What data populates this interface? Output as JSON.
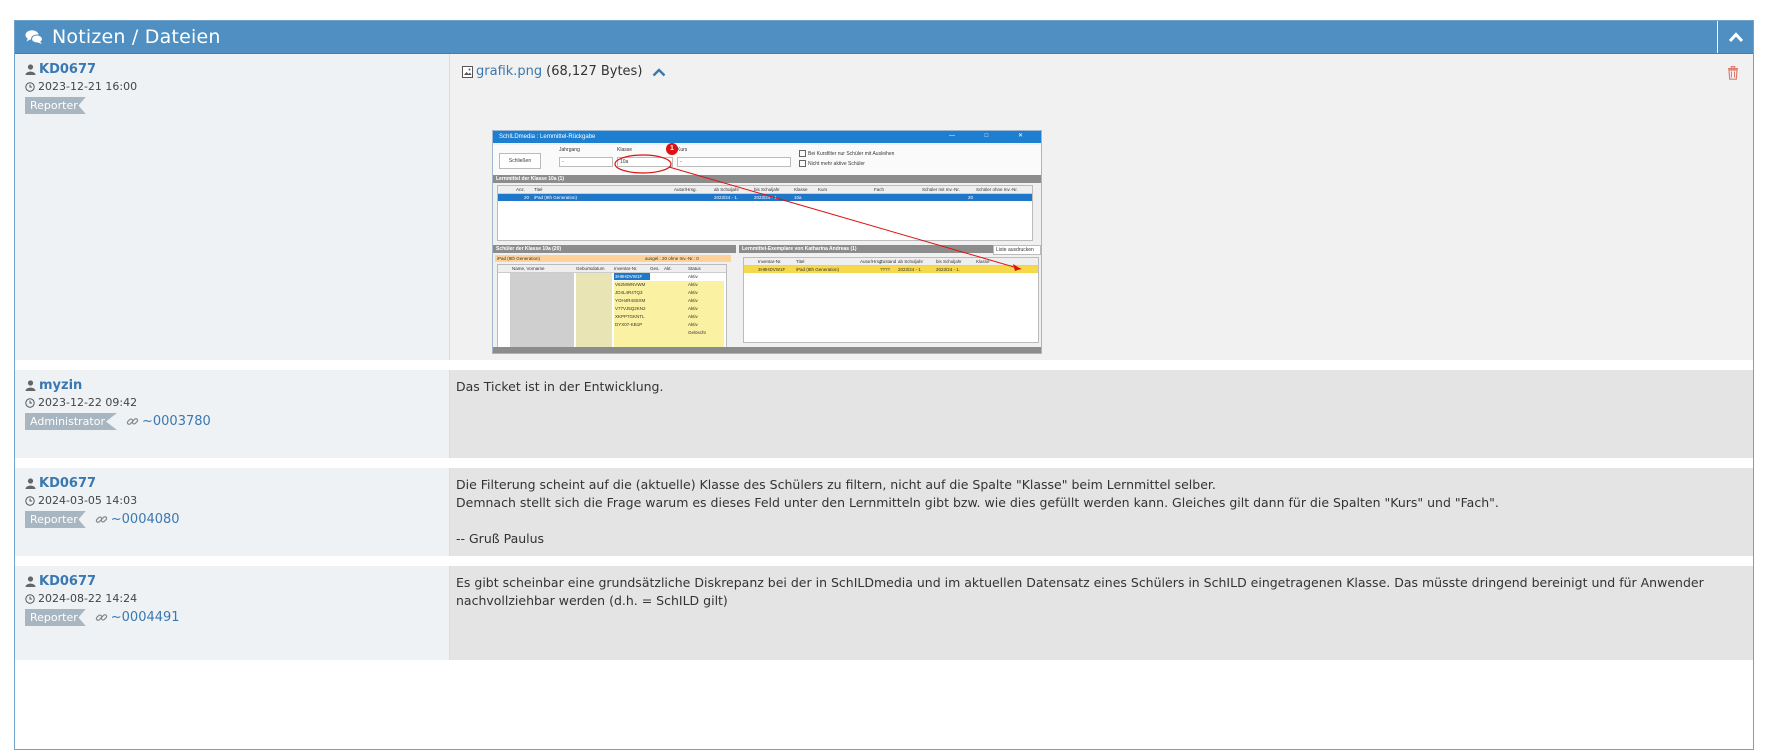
{
  "panel": {
    "title": "Notizen / Dateien",
    "header_color": "#4f8fc1"
  },
  "notes": [
    {
      "user": "KD0677",
      "date": "2023-12-21 16:00",
      "role": "Reporter",
      "link": "",
      "attachment": {
        "file_name": "grafik.png",
        "file_size": "(68,127 Bytes)",
        "preview": {
          "window_title": "SchILDmedia : Lernmittel-Rückgabe",
          "close_button": "Schließen",
          "filter_labels": [
            "Jahrgang",
            "Klasse",
            "Kurs"
          ],
          "filter_values": [
            "-",
            "10a",
            "-"
          ],
          "checkbox_1": "Bei Kursfilter nur Schüler mit Ausleihen",
          "checkbox_2": "Nicht mehr aktive Schüler",
          "section_1": "Lernmittel der Klasse 10a   (1)",
          "columns_1": [
            "Anz.",
            "Titel",
            "Autor/Hrsg.",
            "ab Schuljahr",
            "bis Schuljahr",
            "Klasse",
            "Kurs",
            "Fach",
            "Schüler mit Inv.-Nr.",
            "Schüler ohne Inv.-Nr."
          ],
          "row_1": [
            "20",
            "iPad (9th Generation)",
            "2023/24 - 1.",
            "2023/24 - 1.",
            "10a",
            "20"
          ],
          "section_2": "Schüler der Klasse 10a   (20)",
          "sub_2": "iPad (9th Generation)",
          "sub_2_stats": "ausgel.: 20   ohne Inv.-Nr.: 0",
          "columns_2": [
            "Name, Vorname",
            "Geburtsdatum",
            "Inventar-Nr.",
            "Ges.",
            "Akt.",
            "Status"
          ],
          "inventory": [
            "3H9HDVW1F",
            "V62MWNVWM",
            "JD4L4R4TQ3",
            "YOH4R4S5XM",
            "V77VJ5Q2KN2",
            "XKPP7GKNTL",
            "DYX07-KB1P"
          ],
          "status": [
            "Aktiv",
            "Aktiv",
            "Aktiv",
            "Aktiv",
            "Aktiv",
            "Aktiv",
            "Aktiv",
            "Gelöscht"
          ],
          "section_3": "Lernmittel-Exemplare von   Katharina Andreas   (1)",
          "section_3_button": "Liste ausdrucken",
          "columns_3": [
            "Inventar-Nr.",
            "Titel",
            "Autor/Hrsg.",
            "Zustand",
            "ab Schuljahr",
            "bis Schuljahr",
            "Klasse"
          ],
          "row_3": [
            "3H9HDVW1F",
            "iPad (9th Generation)",
            "????",
            "2023/24 - 1.",
            "2023/24 - 1."
          ],
          "marker": "1"
        }
      }
    },
    {
      "user": "myzin",
      "date": "2023-12-22 09:42",
      "role": "Administrator",
      "link": "~0003780",
      "text": [
        "Das Ticket ist in der Entwicklung."
      ]
    },
    {
      "user": "KD0677",
      "date": "2024-03-05 14:03",
      "role": "Reporter",
      "link": "~0004080",
      "text": [
        "Die Filterung scheint auf die (aktuelle) Klasse des Schülers zu filtern, nicht auf die Spalte \"Klasse\" beim Lernmittel selber.",
        "Demnach stellt sich die Frage warum es dieses Feld unter den Lernmitteln gibt bzw. wie dies gefüllt werden kann. Gleiches gilt dann für die Spalten \"Kurs\" und \"Fach\".",
        "",
        "-- Gruß Paulus"
      ]
    },
    {
      "user": "KD0677",
      "date": "2024-08-22 14:24",
      "role": "Reporter",
      "link": "~0004491",
      "text": [
        "Es gibt scheinbar eine grundsätzliche Diskrepanz bei der in SchILDmedia und im aktuellen Datensatz eines Schülers in SchILD eingetragenen Klasse. Das müsste dringend bereinigt und für Anwender",
        "nachvollziehbar werden (d.h. = SchILD gilt)"
      ]
    }
  ],
  "icons": {
    "header": "comments-icon",
    "collapse": "chevron-up-icon",
    "user": "user-icon",
    "date": "clock-icon",
    "link": "link-icon",
    "file": "image-file-icon",
    "delete": "trash-icon"
  }
}
